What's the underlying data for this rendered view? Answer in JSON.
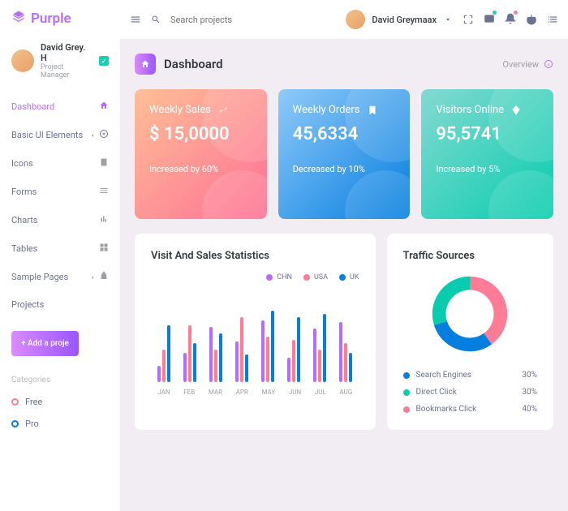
{
  "brand": "Purple",
  "user": {
    "name": "David Grey. H",
    "role": "Project Manager"
  },
  "topbar": {
    "search_placeholder": "Search projects",
    "user_name": "David Greymaax"
  },
  "nav": [
    {
      "label": "Dashboard",
      "icon": "home",
      "active": true
    },
    {
      "label": "Basic UI Elements",
      "icon": "target",
      "chevron": true
    },
    {
      "label": "Icons",
      "icon": "contacts"
    },
    {
      "label": "Forms",
      "icon": "list"
    },
    {
      "label": "Charts",
      "icon": "chart"
    },
    {
      "label": "Tables",
      "icon": "grid"
    },
    {
      "label": "Sample Pages",
      "icon": "bag",
      "chevron": true
    },
    {
      "label": "Projects",
      "icon": ""
    }
  ],
  "add_button": "+ Add a proje",
  "categories": {
    "header": "Categories",
    "items": [
      {
        "label": "Free",
        "color": "#fe7c96"
      },
      {
        "label": "Pro",
        "color": "#047edf"
      }
    ]
  },
  "page": {
    "title": "Dashboard",
    "overview": "Overview"
  },
  "cards": [
    {
      "title": "Weekly Sales",
      "value": "$ 15,0000",
      "sub": "Increased by 60%",
      "icon": "chart-line"
    },
    {
      "title": "Weekly Orders",
      "value": "45,6334",
      "sub": "Decreased by 10%",
      "icon": "bookmark"
    },
    {
      "title": "Visitors Online",
      "value": "95,5741",
      "sub": "Increased by 5%",
      "icon": "diamond"
    }
  ],
  "stats_panel": {
    "title": "Visit And Sales Statistics"
  },
  "traffic_panel": {
    "title": "Traffic Sources",
    "items": [
      {
        "label": "Search Engines",
        "pct": "30%",
        "color": "#047edf"
      },
      {
        "label": "Direct Click",
        "pct": "30%",
        "color": "#07cdae"
      },
      {
        "label": "Bookmarks Click",
        "pct": "40%",
        "color": "#fe7c96"
      }
    ]
  },
  "chart_data": [
    {
      "type": "bar",
      "title": "Visit And Sales Statistics",
      "categories": [
        "JAN",
        "FEB",
        "MAR",
        "APR",
        "MAY",
        "JUN",
        "JUL",
        "AUG"
      ],
      "series": [
        {
          "name": "CHN",
          "color": "#b66dff",
          "values": [
            20,
            36,
            68,
            50,
            76,
            30,
            66,
            74
          ]
        },
        {
          "name": "USA",
          "color": "#fe7c96",
          "values": [
            40,
            70,
            40,
            80,
            56,
            52,
            40,
            48
          ]
        },
        {
          "name": "UK",
          "color": "#047edf",
          "values": [
            70,
            48,
            60,
            34,
            88,
            80,
            84,
            36
          ]
        }
      ],
      "ylim": [
        0,
        100
      ]
    },
    {
      "type": "pie",
      "title": "Traffic Sources",
      "series": [
        {
          "name": "Search Engines",
          "value": 30,
          "color": "#047edf"
        },
        {
          "name": "Direct Click",
          "value": 30,
          "color": "#07cdae"
        },
        {
          "name": "Bookmarks Click",
          "value": 40,
          "color": "#fe7c96"
        }
      ]
    }
  ]
}
